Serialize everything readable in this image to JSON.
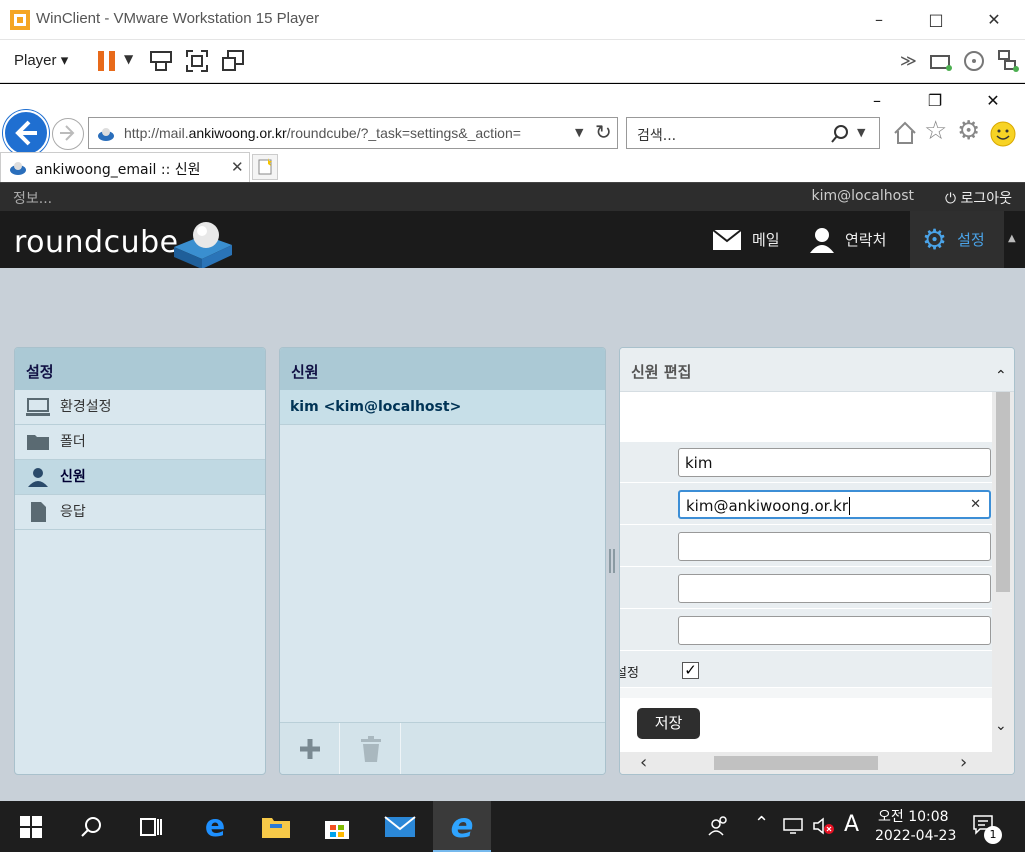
{
  "vmware": {
    "title": "WinClient - VMware Workstation 15 Player",
    "player_menu": "Player"
  },
  "ie": {
    "url_prefix": "http://mail.",
    "url_domain": "ankiwoong.or.kr",
    "url_suffix": "/roundcube/?_task=settings&_action=",
    "search_placeholder": "검색...",
    "tab_title": "ankiwoong_email :: 신원"
  },
  "roundcube": {
    "info": "정보...",
    "user": "kim@localhost",
    "logout": "로그아웃",
    "logo": "roundcube",
    "nav": {
      "mail": "메일",
      "contacts": "연락처",
      "settings": "설정"
    }
  },
  "settings_panel": {
    "title": "설정",
    "items": [
      {
        "label": "환경설정",
        "icon": "computer-icon"
      },
      {
        "label": "폴더",
        "icon": "folder-icon"
      },
      {
        "label": "신원",
        "icon": "person-icon"
      },
      {
        "label": "응답",
        "icon": "document-icon"
      }
    ]
  },
  "identities_panel": {
    "title": "신원",
    "identity": "kim <kim@localhost>"
  },
  "edit_panel": {
    "title": "신원 편집",
    "name_value": "kim",
    "email_value": "kim@ankiwoong.or.kr",
    "checkbox_label": "설정",
    "save_button": "저장"
  },
  "taskbar": {
    "ime": "A",
    "time": "오전 10:08",
    "date": "2022-04-23",
    "notif_count": "1"
  },
  "colors": {
    "accent": "#4aa3e8",
    "ie_blue": "#1f6fd1",
    "pause_orange": "#e86a1a"
  }
}
